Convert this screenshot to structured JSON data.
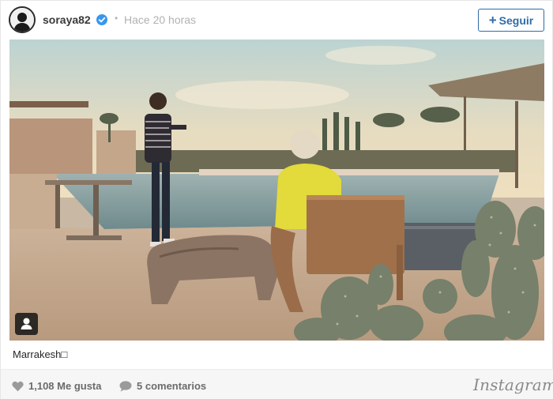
{
  "post": {
    "username": "soraya82",
    "separator": "•",
    "time_ago": "Hace 20 horas",
    "follow_label": "Seguir",
    "follow_plus": "+",
    "caption": "Marrakesh□",
    "photo_description_icon": "user-tag-icon"
  },
  "footer": {
    "likes": "1,108 Me gusta",
    "comments": "5 comentarios",
    "brand": "Instagram"
  },
  "colors": {
    "accent": "#2f6ca6",
    "verified": "#3897f0",
    "muted": "#b2b2b2"
  }
}
